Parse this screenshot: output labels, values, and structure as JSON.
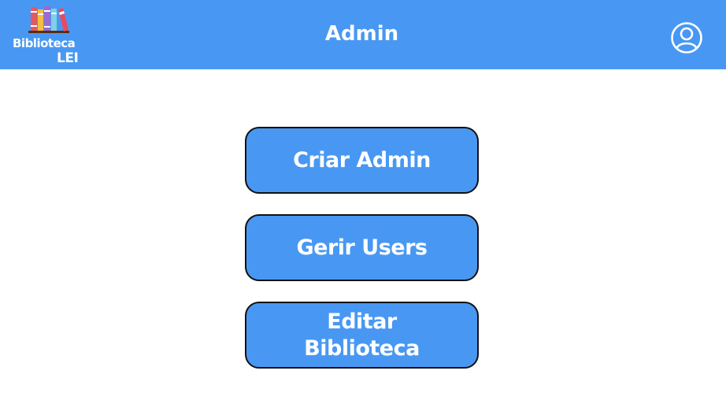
{
  "header": {
    "logo_line1": "Biblioteca",
    "logo_line2": "LEI",
    "title": "Admin",
    "account_icon": "user-circle-icon",
    "background": "#4898f3"
  },
  "menu": {
    "create_admin_label": "Criar Admin",
    "manage_users_label": "Gerir Users",
    "edit_library_label": "Editar Biblioteca",
    "button_color": "#4898f3",
    "border_color": "#111111"
  }
}
